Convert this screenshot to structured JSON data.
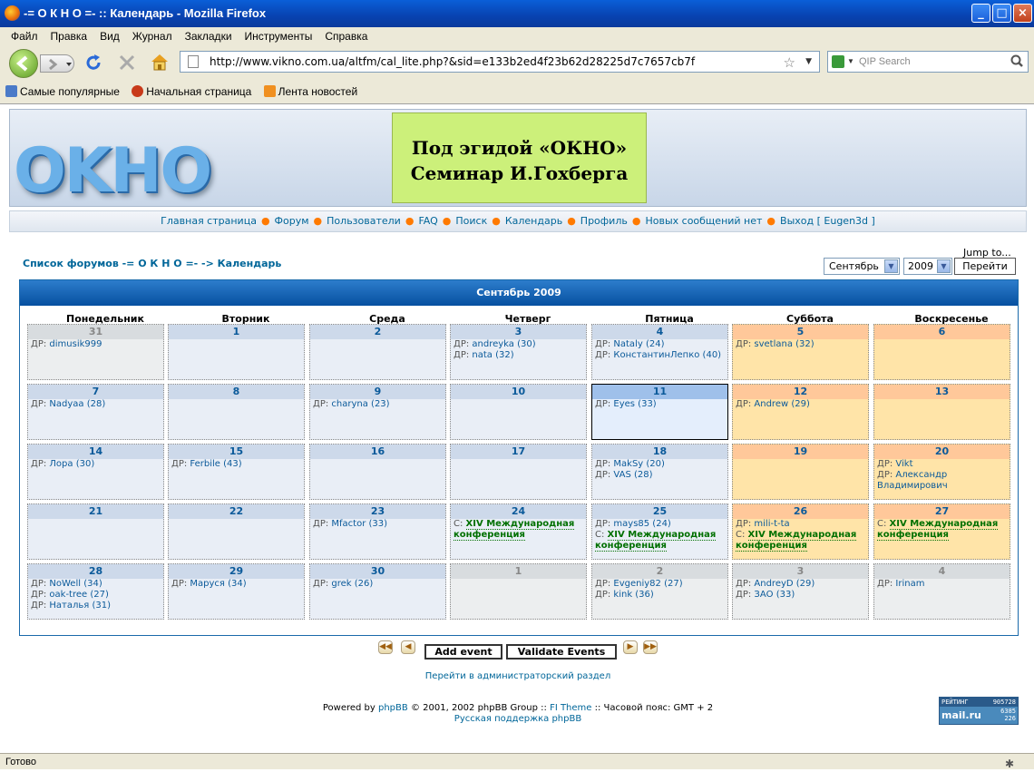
{
  "window": {
    "title": "-= О К Н О =- :: Календарь - Mozilla Firefox",
    "min": "_",
    "max": "□",
    "close": "×"
  },
  "menu": [
    "Файл",
    "Правка",
    "Вид",
    "Журнал",
    "Закладки",
    "Инструменты",
    "Справка"
  ],
  "nav": {
    "url": "http://www.vikno.com.ua/altfm/cal_lite.php?&sid=e133b2ed4f23b62d28225d7c7657cb7f",
    "search_placeholder": "QIP Search"
  },
  "bookmarks": [
    "Самые популярные",
    "Начальная страница",
    "Лента новостей"
  ],
  "site": {
    "logo": "OKHO",
    "banner_line1": "Под эгидой «ОКНО»",
    "banner_line2": "Семинар И.Гохберга"
  },
  "topnav": [
    "Главная страница",
    "Форум",
    "Пользователи",
    "FAQ",
    "Поиск",
    "Календарь",
    "Профиль",
    "Новых сообщений нет",
    "Выход [ Eugen3d ]"
  ],
  "breadcrumb": "Список форумов -= О К Н О =- -> Календарь",
  "jump": {
    "label": "Jump to...",
    "month": "Сентябрь",
    "year": "2009",
    "go": "Перейти"
  },
  "calendar": {
    "title": "Сентябрь 2009",
    "days": [
      "Понедельник",
      "Вторник",
      "Среда",
      "Четверг",
      "Пятница",
      "Суббота",
      "Воскресенье"
    ],
    "weeks": [
      [
        {
          "d": "31",
          "t": "other",
          "ev": [
            {
              "l": "ДР:",
              "n": "dimusik999"
            }
          ]
        },
        {
          "d": "1",
          "ev": []
        },
        {
          "d": "2",
          "ev": []
        },
        {
          "d": "3",
          "ev": [
            {
              "l": "ДР:",
              "n": "andreyka (30)"
            },
            {
              "l": "ДР:",
              "n": "nata (32)"
            }
          ]
        },
        {
          "d": "4",
          "ev": [
            {
              "l": "ДР:",
              "n": "Nataly (24)"
            },
            {
              "l": "ДР:",
              "n": "КонстантинЛепко (40)"
            }
          ]
        },
        {
          "d": "5",
          "t": "we",
          "ev": [
            {
              "l": "ДР:",
              "n": "svetlana (32)"
            }
          ]
        },
        {
          "d": "6",
          "t": "we",
          "ev": []
        }
      ],
      [
        {
          "d": "7",
          "ev": [
            {
              "l": "ДР:",
              "n": "Nadyaa (28)"
            }
          ]
        },
        {
          "d": "8",
          "ev": []
        },
        {
          "d": "9",
          "ev": [
            {
              "l": "ДР:",
              "n": "charyna (23)"
            }
          ]
        },
        {
          "d": "10",
          "ev": []
        },
        {
          "d": "11",
          "t": "today",
          "ev": [
            {
              "l": "ДР:",
              "n": "Eyes (33)"
            }
          ]
        },
        {
          "d": "12",
          "t": "we",
          "ev": [
            {
              "l": "ДР:",
              "n": "Andrew (29)"
            }
          ]
        },
        {
          "d": "13",
          "t": "we",
          "ev": []
        }
      ],
      [
        {
          "d": "14",
          "ev": [
            {
              "l": "ДР:",
              "n": "Лора (30)"
            }
          ]
        },
        {
          "d": "15",
          "ev": [
            {
              "l": "ДР:",
              "n": "Ferbile (43)"
            }
          ]
        },
        {
          "d": "16",
          "ev": []
        },
        {
          "d": "17",
          "ev": []
        },
        {
          "d": "18",
          "ev": [
            {
              "l": "ДР:",
              "n": "MakSy (20)"
            },
            {
              "l": "ДР:",
              "n": "VAS (28)"
            }
          ]
        },
        {
          "d": "19",
          "t": "we",
          "ev": []
        },
        {
          "d": "20",
          "t": "we",
          "ev": [
            {
              "l": "ДР:",
              "n": "Vikt"
            },
            {
              "l": "ДР:",
              "n": "Александр Владимирович"
            }
          ]
        }
      ],
      [
        {
          "d": "21",
          "ev": []
        },
        {
          "d": "22",
          "ev": []
        },
        {
          "d": "23",
          "ev": [
            {
              "l": "ДР:",
              "n": "Mfactor (33)"
            }
          ]
        },
        {
          "d": "24",
          "ev": [
            {
              "l": "С:",
              "c": "XIV Международная конференция"
            }
          ]
        },
        {
          "d": "25",
          "ev": [
            {
              "l": "ДР:",
              "n": "mays85 (24)"
            },
            {
              "l": "С:",
              "c": "XIV Международная конференция"
            }
          ]
        },
        {
          "d": "26",
          "t": "we",
          "ev": [
            {
              "l": "ДР:",
              "n": "mili-t-ta"
            },
            {
              "l": "С:",
              "c": "XIV Международная конференция"
            }
          ]
        },
        {
          "d": "27",
          "t": "we",
          "ev": [
            {
              "l": "С:",
              "c": "XIV Международная конференция"
            }
          ]
        }
      ],
      [
        {
          "d": "28",
          "ev": [
            {
              "l": "ДР:",
              "n": "NoWell (34)"
            },
            {
              "l": "ДР:",
              "n": "oak-tree (27)"
            },
            {
              "l": "ДР:",
              "n": "Наталья (31)"
            }
          ]
        },
        {
          "d": "29",
          "ev": [
            {
              "l": "ДР:",
              "n": "Маруся (34)"
            }
          ]
        },
        {
          "d": "30",
          "ev": [
            {
              "l": "ДР:",
              "n": "grek (26)"
            }
          ]
        },
        {
          "d": "1",
          "t": "other",
          "ev": []
        },
        {
          "d": "2",
          "t": "other",
          "ev": [
            {
              "l": "ДР:",
              "n": "Evgeniy82 (27)"
            },
            {
              "l": "ДР:",
              "n": "kink (36)"
            }
          ]
        },
        {
          "d": "3",
          "t": "other",
          "ev": [
            {
              "l": "ДР:",
              "n": "AndreyD (29)"
            },
            {
              "l": "ДР:",
              "n": "ЗАО (33)"
            }
          ]
        },
        {
          "d": "4",
          "t": "other",
          "ev": [
            {
              "l": "ДР:",
              "n": "Irinam"
            }
          ]
        }
      ]
    ]
  },
  "actions": {
    "add": "Add event",
    "validate": "Validate Events",
    "first": "◀◀",
    "prev": "◀",
    "next": "▶",
    "last": "▶▶"
  },
  "admin_link": "Перейти в администраторский раздел",
  "footer": {
    "powered": "Powered by",
    "phpbb": "phpBB",
    "copy": "© 2001, 2002 phpBB Group ::",
    "theme": "FI Theme",
    "tz": ":: Часовой пояс: GMT + 2",
    "support": "Русская поддержка phpBB"
  },
  "counter": {
    "label": "РЕЙТИНГ",
    "brand": "mail.ru",
    "v1": "905728",
    "v2": "6385",
    "v3": "226"
  },
  "status": "Готово"
}
